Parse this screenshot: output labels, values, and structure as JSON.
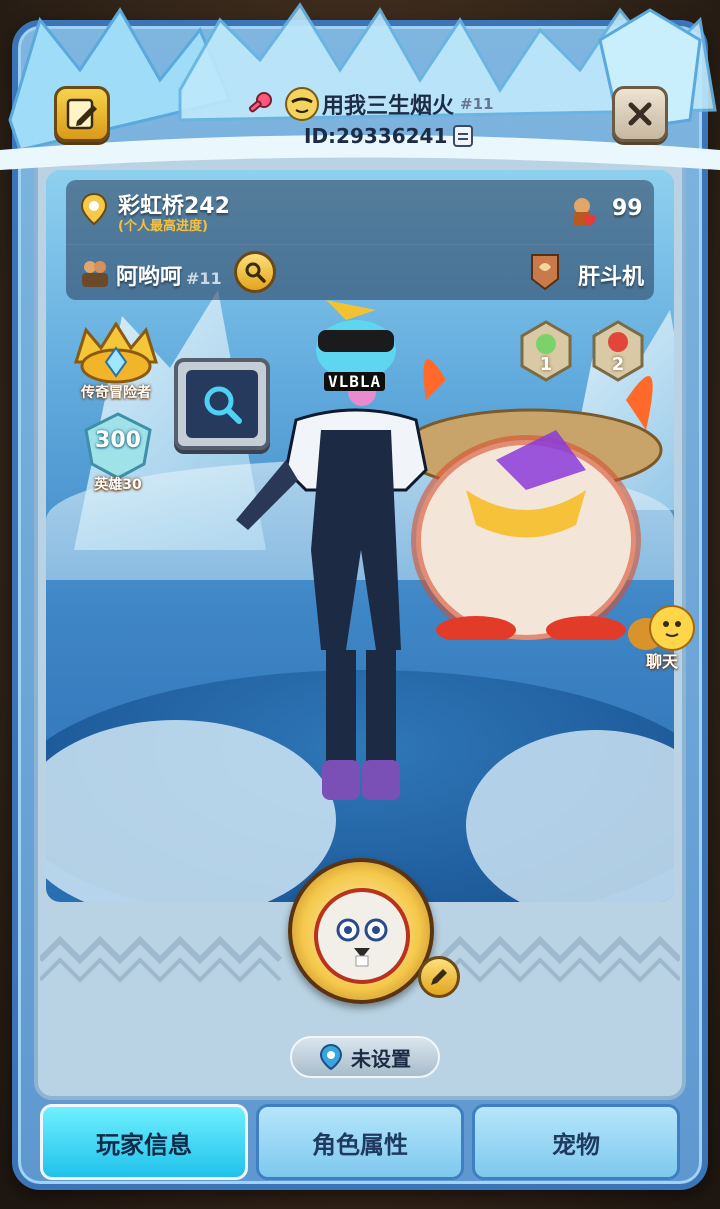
{
  "header": {
    "player_name": "用我三生烟火",
    "player_tag": "#11",
    "player_id": "ID:29336241"
  },
  "progress": {
    "location": "彩虹桥242",
    "location_sub": "(个人最高进度)",
    "likes": "99"
  },
  "guild": {
    "name": "阿哟呵",
    "tag": "#11",
    "title": "肝斗机"
  },
  "badges": {
    "rank_label": "传奇冒险者",
    "hero_count": "300",
    "hero_label": "英雄30"
  },
  "medals": [
    "1",
    "2"
  ],
  "character": {
    "visor_text": "VLBLA"
  },
  "location_button": "未设置",
  "chat_label": "聊天",
  "tabs": [
    {
      "label": "玩家信息",
      "active": true
    },
    {
      "label": "角色属性",
      "active": false
    },
    {
      "label": "宠物",
      "active": false
    }
  ],
  "colors": {
    "frame": "#3c74b8",
    "accent_active_tab": "#1fc1ea",
    "gold": "#f4c84a"
  },
  "icons": [
    "edit-icon",
    "close-icon",
    "key-icon",
    "avatar-icon",
    "copy-icon",
    "location-pin-icon",
    "like-icon",
    "guild-icon",
    "search-icon",
    "guild-emblem-icon",
    "chat-icon",
    "pencil-icon"
  ]
}
